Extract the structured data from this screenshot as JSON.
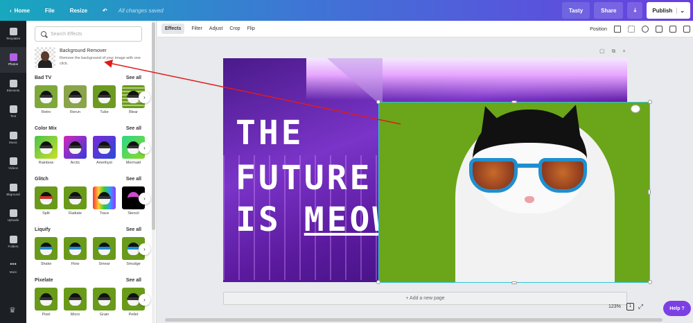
{
  "topbar": {
    "home": "Home",
    "file": "File",
    "resize": "Resize",
    "saved": "All changes saved",
    "tasty": "Tasty",
    "share": "Share",
    "publish": "Publish"
  },
  "rail": {
    "items": [
      {
        "label": "Templates"
      },
      {
        "label": "Photos"
      },
      {
        "label": "Elements"
      },
      {
        "label": "Text"
      },
      {
        "label": "Music"
      },
      {
        "label": "Videos"
      },
      {
        "label": "Bkground"
      },
      {
        "label": "Uploads"
      },
      {
        "label": "Folders"
      },
      {
        "label": "More"
      }
    ]
  },
  "panel": {
    "search_placeholder": "Search Effects",
    "bg_remover": {
      "title": "Background Remover",
      "desc": "Remove the background of your image with one click."
    },
    "sections": [
      {
        "title": "Bad TV",
        "see_all": "See all",
        "items": [
          "Retro",
          "Rerun",
          "Tube",
          "Blear"
        ]
      },
      {
        "title": "Color Mix",
        "see_all": "See all",
        "items": [
          "Rainbow",
          "Arctic",
          "Amethyst",
          "Mermaid"
        ]
      },
      {
        "title": "Glitch",
        "see_all": "See all",
        "items": [
          "Split",
          "Radiate",
          "Trace",
          "Stencil"
        ]
      },
      {
        "title": "Liquify",
        "see_all": "See all",
        "items": [
          "Shake",
          "Flow",
          "Smear",
          "Smudge"
        ]
      },
      {
        "title": "Pixelate",
        "see_all": "See all",
        "items": [
          "Pixel",
          "Micro",
          "Grain",
          "Pellet"
        ]
      }
    ]
  },
  "toolbar": {
    "effects": "Effects",
    "filter": "Filter",
    "adjust": "Adjust",
    "crop": "Crop",
    "flip": "Flip",
    "position": "Position"
  },
  "design": {
    "line1": "THE",
    "line2": "FUTURE",
    "line3a": "IS ",
    "line3b": "MEOW"
  },
  "bottom": {
    "add_page": "+ Add a new page",
    "zoom": "123%",
    "page_num": "1",
    "help": "Help ?"
  },
  "colors": {
    "accent": "#7b3fe4",
    "selection": "#2ec4d8",
    "annotation_arrow": "#e01b1b"
  }
}
